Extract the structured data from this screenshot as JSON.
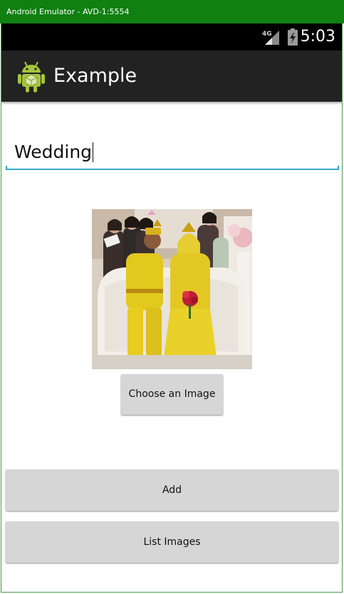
{
  "window": {
    "title": "Android Emulator - AVD-1:5554"
  },
  "statusbar": {
    "network": "4G",
    "time": "5:03",
    "icons": [
      "signal-icon",
      "battery-icon"
    ]
  },
  "actionbar": {
    "icon": "android-icon",
    "title": "Example"
  },
  "form": {
    "name_value": "Wedding",
    "image": "wedding-photo",
    "choose_label": "Choose an Image",
    "add_label": "Add",
    "list_label": "List Images"
  },
  "colors": {
    "titlebar": "#108010",
    "actionbar": "#222222",
    "accent_underline": "#33a8c8",
    "button": "#d6d6d6"
  }
}
